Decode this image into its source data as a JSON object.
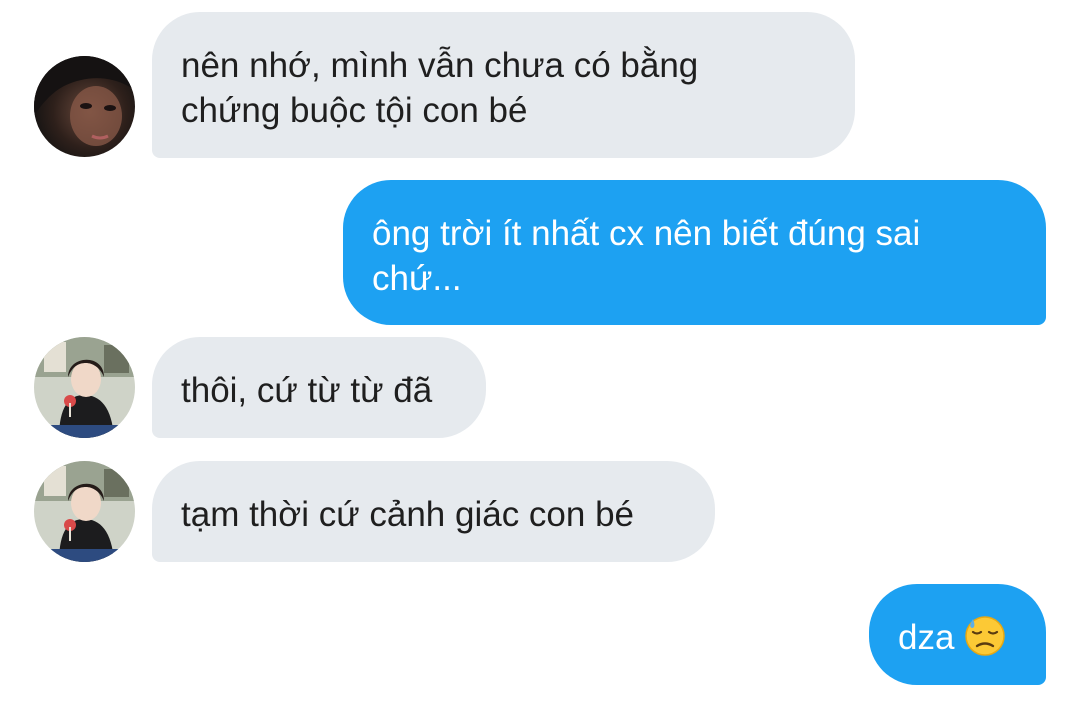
{
  "messages": [
    {
      "direction": "incoming",
      "avatar_icon": "dark-portrait-avatar",
      "lines": [
        "nên nhớ, mình vẫn chưa có bằng",
        "chứng buộc tội con bé"
      ]
    },
    {
      "direction": "outgoing",
      "lines": [
        "ông trời ít nhất cx nên biết đúng sai",
        "chứ..."
      ]
    },
    {
      "direction": "incoming",
      "avatar_icon": "photo-portrait-avatar",
      "lines": [
        "thôi, cứ từ từ đã"
      ]
    },
    {
      "direction": "incoming",
      "avatar_icon": "photo-portrait-avatar",
      "lines": [
        "tạm thời cứ cảnh giác con bé"
      ]
    },
    {
      "direction": "outgoing",
      "lines": [
        "dza"
      ],
      "emoji": "downcast-face-with-sweat-emoji"
    }
  ],
  "colors": {
    "incoming_bubble": "#e6eaee",
    "outgoing_bubble": "#1da1f2",
    "incoming_text": "#1f1f1f",
    "outgoing_text": "#ffffff"
  }
}
